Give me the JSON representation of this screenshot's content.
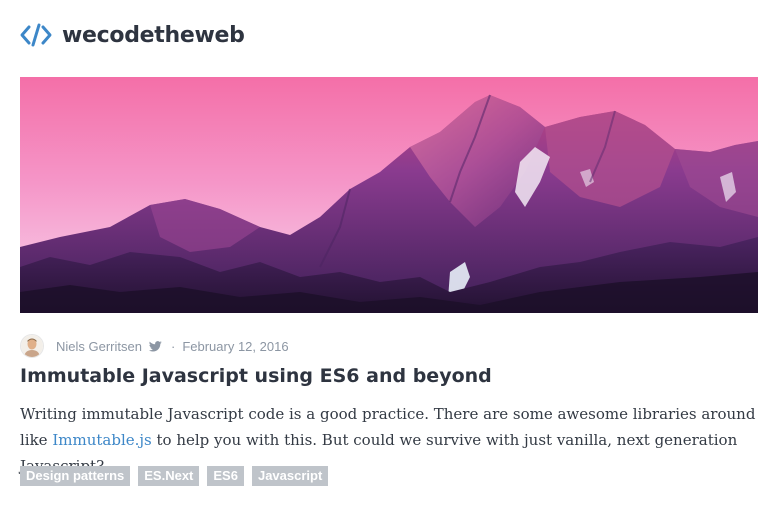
{
  "site": {
    "logo_text": "wecodetheweb",
    "logo_icon": "code-brackets-icon",
    "accent_color": "#3d87c8"
  },
  "hero": {
    "image": "mountain-range-pink-purple-sky"
  },
  "post": {
    "author": "Niels Gerritsen",
    "separator": "·",
    "date": "February 12, 2016",
    "title": "Immutable Javascript using ES6 and beyond",
    "excerpt_before_link": "Writing immutable Javascript code is a good practice. There are some awesome libraries around like ",
    "excerpt_link": "Immutable.js",
    "excerpt_after_link": " to help you with this. But could we survive with just vanilla, next generation Javascript?",
    "tags": [
      "Design patterns",
      "ES.Next",
      "ES6",
      "Javascript"
    ]
  }
}
